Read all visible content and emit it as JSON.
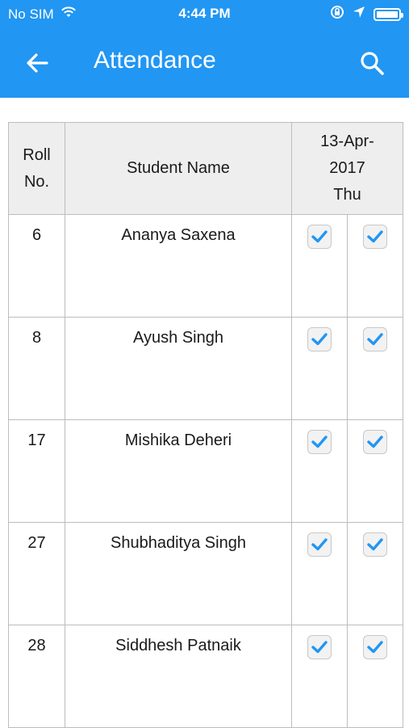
{
  "status_bar": {
    "carrier": "No SIM",
    "time": "4:44 PM"
  },
  "toolbar": {
    "title": "Attendance"
  },
  "table": {
    "headers": {
      "roll": "Roll\nNo.",
      "name": "Student Name",
      "date_line1": "13-Apr-",
      "date_line2": "2017",
      "date_line3": "Thu"
    },
    "rows": [
      {
        "roll": "6",
        "name": "Ananya Saxena",
        "check1": true,
        "check2": true
      },
      {
        "roll": "8",
        "name": "Ayush Singh",
        "check1": true,
        "check2": true
      },
      {
        "roll": "17",
        "name": "Mishika Deheri",
        "check1": true,
        "check2": true
      },
      {
        "roll": "27",
        "name": "Shubhaditya Singh",
        "check1": true,
        "check2": true
      },
      {
        "roll": "28",
        "name": "Siddhesh Patnaik",
        "check1": true,
        "check2": true
      }
    ]
  },
  "colors": {
    "accent": "#2196f3",
    "header_bg": "#eeeeee",
    "check": "#2196f3"
  }
}
